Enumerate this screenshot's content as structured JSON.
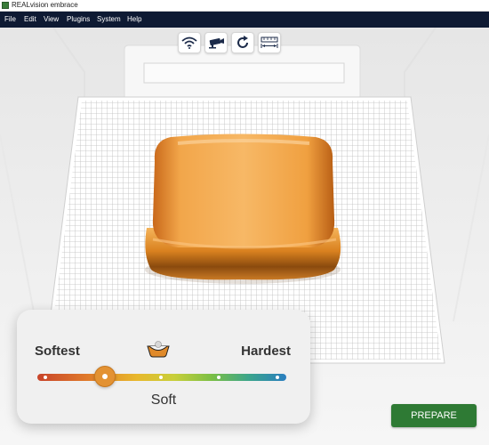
{
  "window": {
    "title": "REALvision embrace"
  },
  "menu": {
    "items": [
      "File",
      "Edit",
      "View",
      "Plugins",
      "System",
      "Help"
    ]
  },
  "toolbar": {
    "icons": [
      "wifi-icon",
      "camera-icon",
      "rotate-icon",
      "measure-icon"
    ],
    "measure_caption": ""
  },
  "hardness": {
    "left_label": "Softest",
    "right_label": "Hardest",
    "value_label": "Soft",
    "level_fraction": 0.28,
    "steps": 5
  },
  "actions": {
    "prepare_label": "PREPARE"
  },
  "colors": {
    "menubar": "#0e1a33",
    "model": "#e08a2a",
    "prepare": "#2e7a34"
  }
}
